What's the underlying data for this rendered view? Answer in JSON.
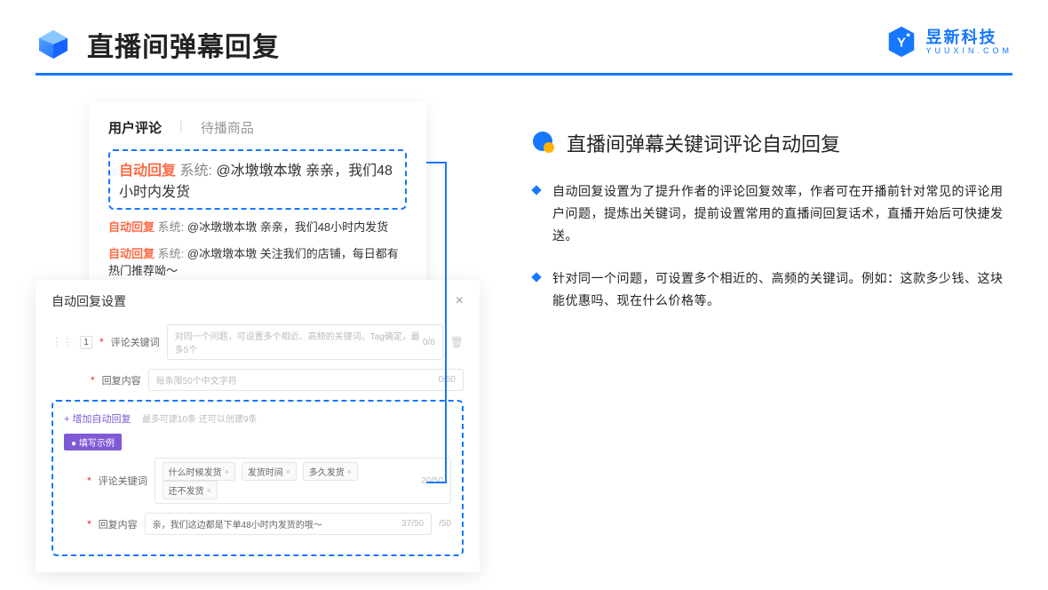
{
  "header": {
    "title": "直播间弹幕回复"
  },
  "brand": {
    "cn": "昱新科技",
    "en": "YUUXIN.COM"
  },
  "commentCard": {
    "tabActive": "用户评论",
    "tabInactive": "待播商品",
    "highlightAuto": "自动回复",
    "highlightSys": "系统:",
    "highlightBody": "@冰墩墩本墩 亲亲，我们48小时内发货",
    "line2Auto": "自动回复",
    "line2Sys": "系统:",
    "line2Body": "@冰墩墩本墩 亲亲，我们48小时内发货",
    "line3Auto": "自动回复",
    "line3Sys": "系统:",
    "line3Body": "@冰墩墩本墩 关注我们的店铺，每日都有热门推荐呦～"
  },
  "settings": {
    "title": "自动回复设置",
    "idx": "1",
    "keywordLabel": "评论关键词",
    "keywordPlaceholder": "对同一个问题，可设置多个相近、高频的关键词。Tag确定，最多5个",
    "keywordCount": "0/6",
    "replyLabel": "回复内容",
    "replyPlaceholder": "每条限50个中文字符",
    "replyCount": "0/50",
    "addLink": "+ 增加自动回复",
    "addHint": "最多可建10条 还可以创建9条",
    "fillBadge": "● 填写示例",
    "exKwLabel": "评论关键词",
    "exTags": [
      "什么时候发货",
      "发货时间",
      "多久发货",
      "还不发货"
    ],
    "exKwCount": "20/50",
    "exReplyLabel": "回复内容",
    "exReplyText": "亲，我们这边都是下单48小时内发货的哦～",
    "exReplyCount": "37/50",
    "outerCount": "/50"
  },
  "right": {
    "sectionTitle": "直播间弹幕关键词评论自动回复",
    "para1": "自动回复设置为了提升作者的评论回复效率，作者可在开播前针对常见的评论用户问题，提炼出关键词，提前设置常用的直播间回复话术，直播开始后可快捷发送。",
    "para2": "针对同一个问题，可设置多个相近的、高频的关键词。例如：这款多少钱、这块能优惠吗、现在什么价格等。"
  }
}
